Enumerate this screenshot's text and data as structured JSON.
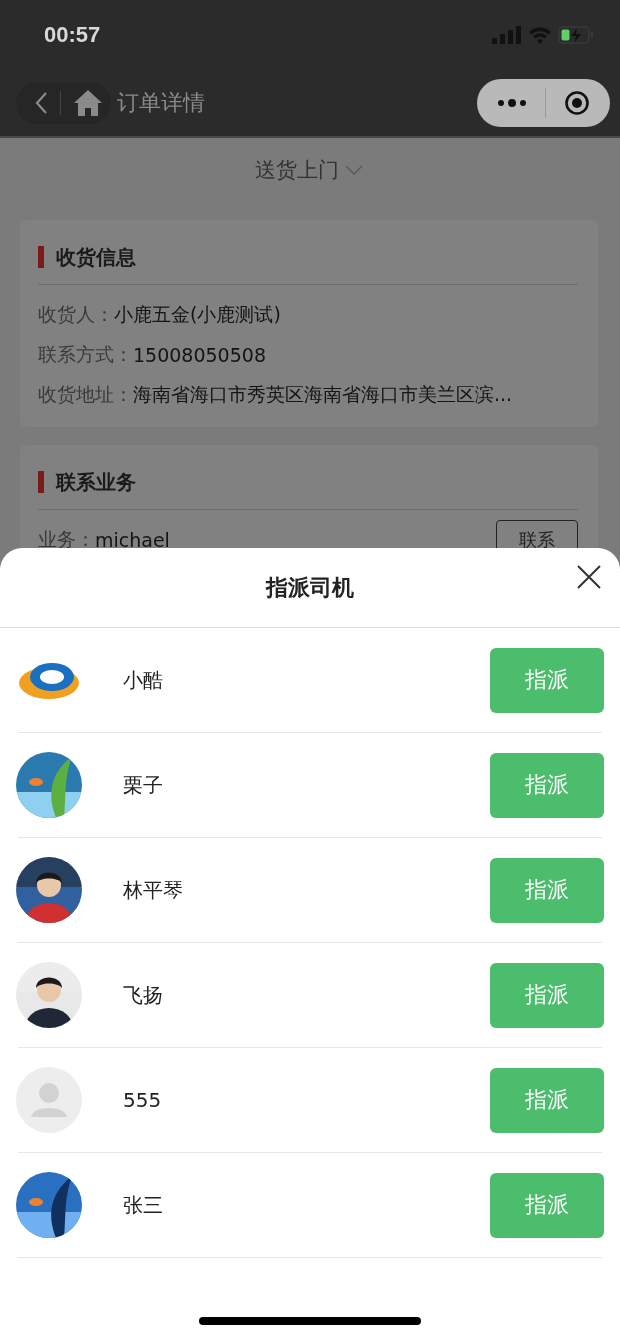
{
  "status_bar": {
    "time": "00:57"
  },
  "nav": {
    "title": "订单详情"
  },
  "delivery_method": {
    "label": "送货上门"
  },
  "receiver_card": {
    "title": "收货信息",
    "fields": [
      {
        "label": "收货人：",
        "value": "小鹿五金(小鹿测试)"
      },
      {
        "label": "联系方式：",
        "value": "15008050508"
      },
      {
        "label": "收货地址：",
        "value": "海南省海口市秀英区海南省海口市美兰区滨..."
      }
    ]
  },
  "sales_card": {
    "title": "联系业务",
    "label": "业务：",
    "value": "michael",
    "button": "联系"
  },
  "sheet": {
    "title": "指派司机",
    "drivers": [
      {
        "name": "小酷",
        "button": "指派"
      },
      {
        "name": "栗子",
        "button": "指派"
      },
      {
        "name": "林平琴",
        "button": "指派"
      },
      {
        "name": "飞扬",
        "button": "指派"
      },
      {
        "name": "555",
        "kind": "default",
        "button": "指派"
      },
      {
        "name": "张三",
        "button": "指派"
      }
    ]
  }
}
